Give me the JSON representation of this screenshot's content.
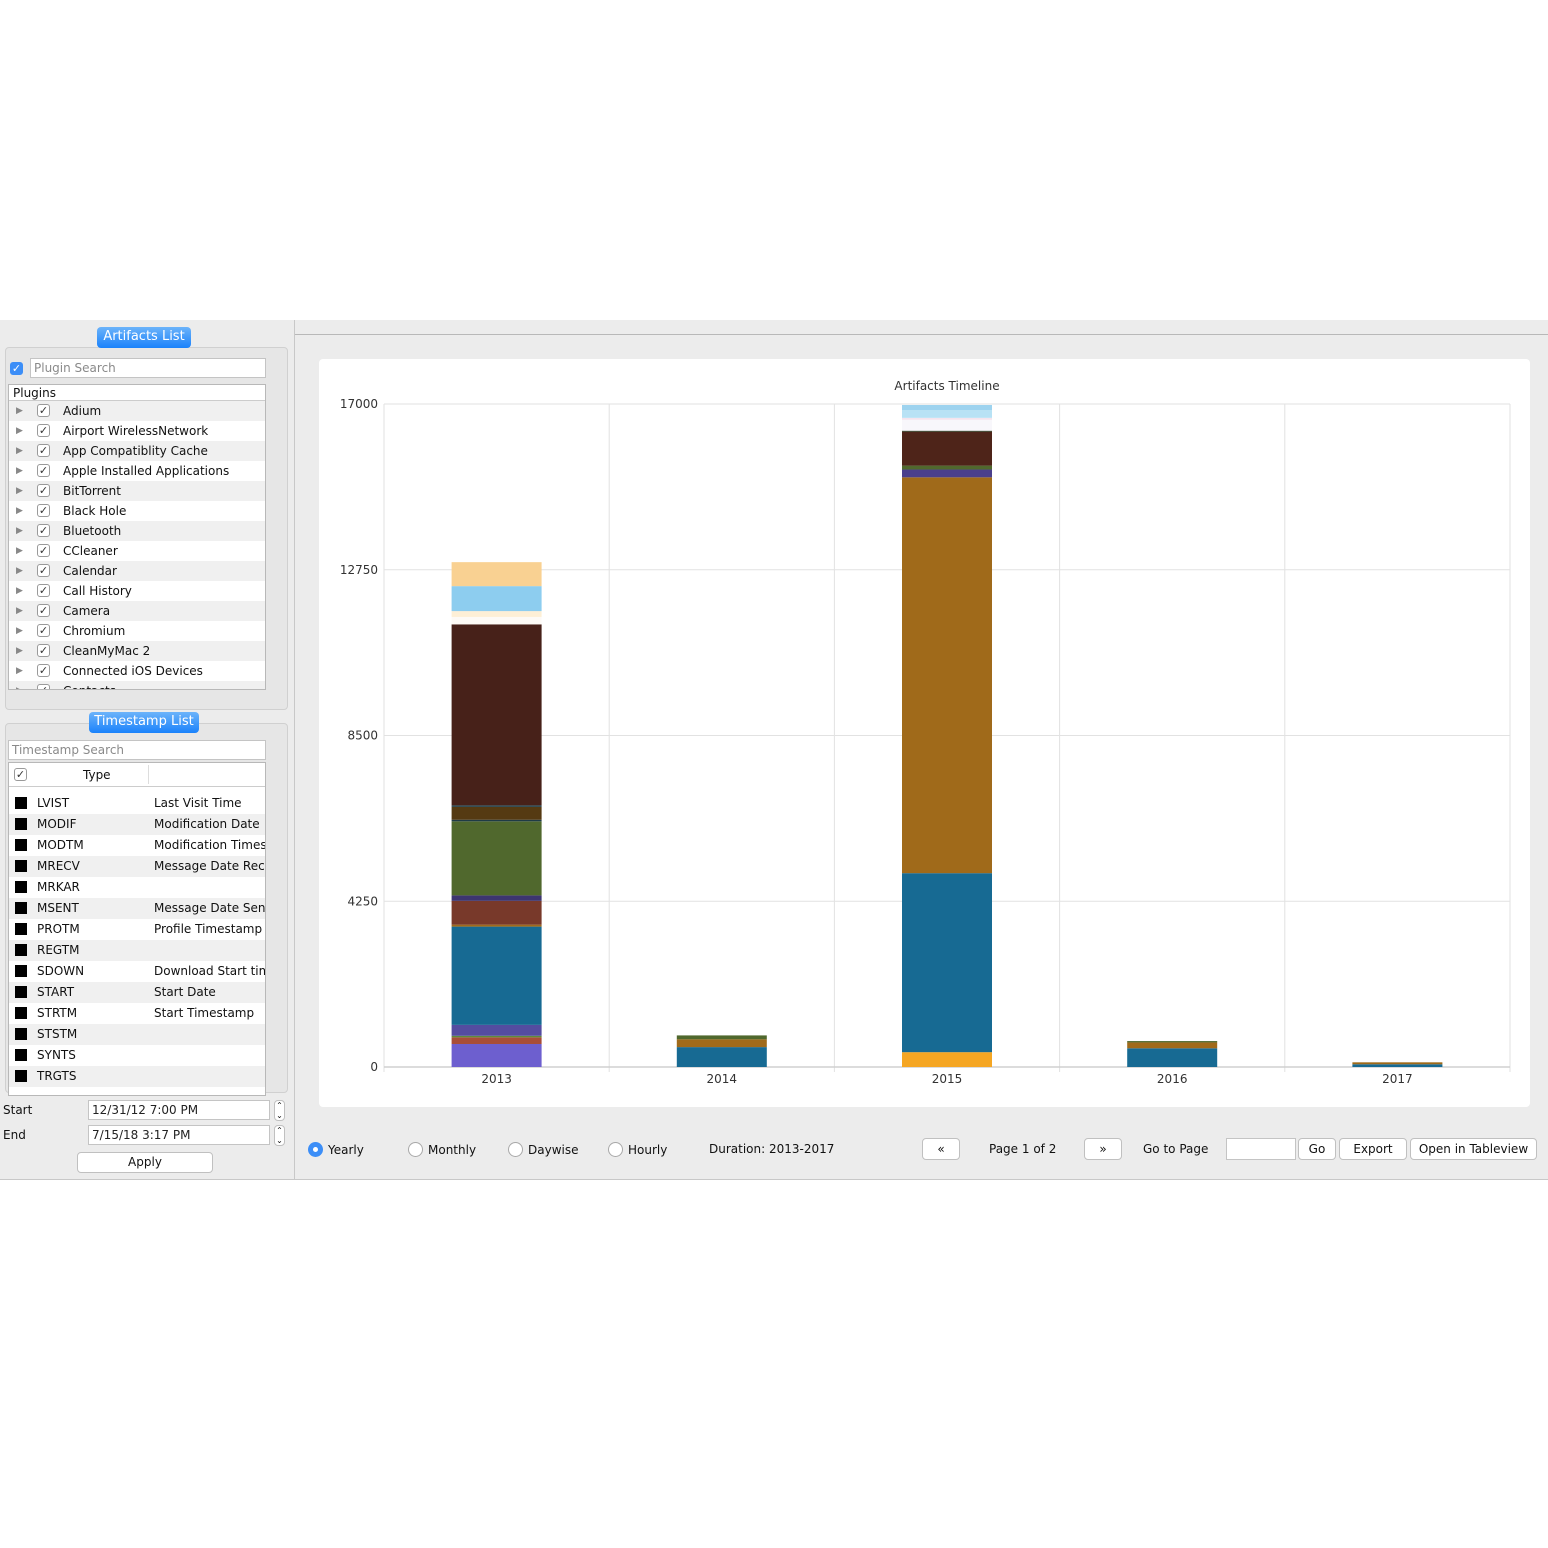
{
  "artifacts": {
    "tab_label": "Artifacts List",
    "search_placeholder": "Plugin Search",
    "list_header": "Plugins",
    "plugins": [
      "Adium",
      "Airport WirelessNetwork",
      "App Compatiblity Cache",
      "Apple Installed Applications",
      "BitTorrent",
      "Black Hole",
      "Bluetooth",
      "CCleaner",
      "Calendar",
      "Call History",
      "Camera",
      "Chromium",
      "CleanMyMac 2",
      "Connected iOS Devices",
      "Contacts"
    ]
  },
  "timestamps": {
    "tab_label": "Timestamp List",
    "search_placeholder": "Timestamp Search",
    "column_type": "Type",
    "rows": [
      {
        "code": "LVIST",
        "desc": "Last Visit Time"
      },
      {
        "code": "MODIF",
        "desc": "Modification Date"
      },
      {
        "code": "MODTM",
        "desc": "Modification Times"
      },
      {
        "code": "MRECV",
        "desc": "Message Date Rece"
      },
      {
        "code": "MRKAR",
        "desc": ""
      },
      {
        "code": "MSENT",
        "desc": "Message Date Sent"
      },
      {
        "code": "PROTM",
        "desc": "Profile Timestamp"
      },
      {
        "code": "REGTM",
        "desc": ""
      },
      {
        "code": "SDOWN",
        "desc": "Download Start tim"
      },
      {
        "code": "START",
        "desc": "Start Date"
      },
      {
        "code": "STRTM",
        "desc": "Start Timestamp"
      },
      {
        "code": "STSTM",
        "desc": ""
      },
      {
        "code": "SYNTS",
        "desc": ""
      },
      {
        "code": "TRGTS",
        "desc": ""
      }
    ]
  },
  "range": {
    "start_label": "Start",
    "start_value": "12/31/12 7:00 PM",
    "end_label": "End",
    "end_value": "7/15/18 3:17 PM",
    "apply_label": "Apply"
  },
  "controls": {
    "granularity": [
      "Yearly",
      "Monthly",
      "Daywise",
      "Hourly"
    ],
    "selected": "Yearly",
    "duration": "Duration:  2013-2017",
    "prev_icon": "«",
    "next_icon": "»",
    "page": "Page 1 of 2",
    "go_to_page": "Go to Page",
    "page_input": "",
    "go_label": "Go",
    "export_label": "Export",
    "tableview_label": "Open in Tableview"
  },
  "chart_data": {
    "type": "bar",
    "stacked": true,
    "title": "Artifacts Timeline",
    "xlabel": "",
    "ylabel": "",
    "ylim": [
      0,
      17000
    ],
    "yticks": [
      "0",
      "4250",
      "8500",
      "12750",
      "17000"
    ],
    "grid": true,
    "categories": [
      "2013",
      "2014",
      "2015",
      "2016",
      "2017"
    ],
    "stacks": [
      {
        "category": "2013",
        "segments": [
          {
            "value": 590,
            "color": "#6d5fcf"
          },
          {
            "value": 170,
            "color": "#a84d38"
          },
          {
            "value": 40,
            "color": "#5f8a3a"
          },
          {
            "value": 280,
            "color": "#544ca0"
          },
          {
            "value": 2520,
            "color": "#176a93"
          },
          {
            "value": 50,
            "color": "#a06a1a"
          },
          {
            "value": 610,
            "color": "#78392a"
          },
          {
            "value": 140,
            "color": "#3d3570"
          },
          {
            "value": 1900,
            "color": "#50682d"
          },
          {
            "value": 40,
            "color": "#1e3b46"
          },
          {
            "value": 330,
            "color": "#553a12"
          },
          {
            "value": 40,
            "color": "#1e3b46"
          },
          {
            "value": 4640,
            "color": "#472119"
          },
          {
            "value": 190,
            "color": "#fdfaf6"
          },
          {
            "value": 150,
            "color": "#fdefd6"
          },
          {
            "value": 640,
            "color": "#8dcdef"
          },
          {
            "value": 615,
            "color": "#f9d192"
          }
        ]
      },
      {
        "category": "2014",
        "segments": [
          {
            "value": 510,
            "color": "#176a93"
          },
          {
            "value": 200,
            "color": "#a06a1a"
          },
          {
            "value": 100,
            "color": "#50682d"
          }
        ]
      },
      {
        "category": "2015",
        "segments": [
          {
            "value": 380,
            "color": "#f5a623"
          },
          {
            "value": 4590,
            "color": "#176a93"
          },
          {
            "value": 10150,
            "color": "#a06a1a"
          },
          {
            "value": 200,
            "color": "#4a3f8c"
          },
          {
            "value": 100,
            "color": "#50682d"
          },
          {
            "value": 870,
            "color": "#4e2419"
          },
          {
            "value": 25,
            "color": "#2a3a20"
          },
          {
            "value": 280,
            "color": "#f8f7fb"
          },
          {
            "value": 50,
            "color": "#f4e4ee"
          },
          {
            "value": 200,
            "color": "#b8e2f5"
          },
          {
            "value": 130,
            "color": "#9dd3ef"
          }
        ]
      },
      {
        "category": "2016",
        "segments": [
          {
            "value": 480,
            "color": "#176a93"
          },
          {
            "value": 150,
            "color": "#a06a1a"
          },
          {
            "value": 35,
            "color": "#50682d"
          }
        ]
      },
      {
        "category": "2017",
        "segments": [
          {
            "value": 70,
            "color": "#176a93"
          },
          {
            "value": 50,
            "color": "#a06a1a"
          }
        ]
      }
    ]
  }
}
